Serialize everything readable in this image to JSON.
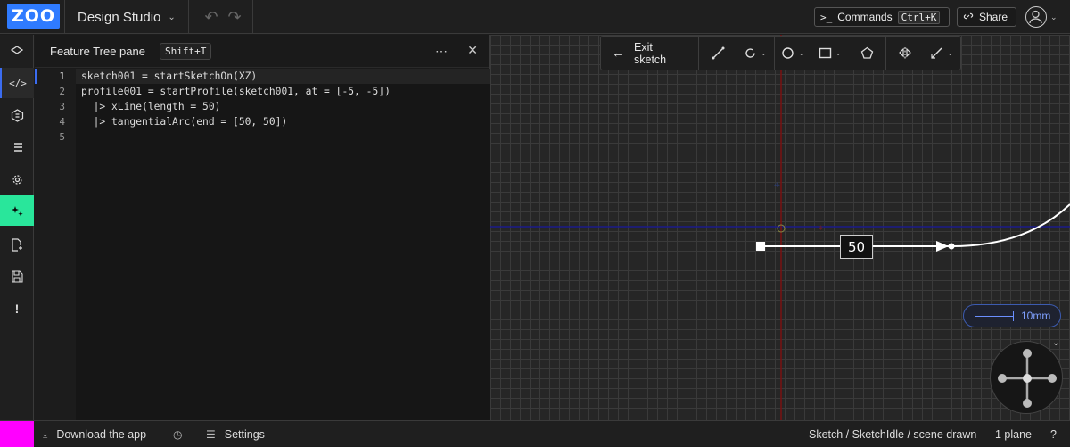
{
  "header": {
    "logo_text": "ZOO",
    "project_name": "Design Studio",
    "commands_label": "Commands",
    "commands_shortcut": "Ctrl+K",
    "share_label": "Share"
  },
  "sidebar": {
    "items": [
      {
        "icon": "layers-icon"
      },
      {
        "icon": "code-icon"
      },
      {
        "icon": "feature-tree-icon"
      },
      {
        "icon": "list-icon"
      },
      {
        "icon": "gear-icon"
      },
      {
        "icon": "sparkle-icon",
        "active": true
      },
      {
        "icon": "file-export-icon"
      },
      {
        "icon": "save-icon"
      },
      {
        "icon": "alert-icon"
      }
    ]
  },
  "pane": {
    "title": "Feature Tree pane",
    "shortcut": "Shift+T",
    "more_glyph": "⋯",
    "close_glyph": "✕"
  },
  "editor": {
    "line_numbers": [
      "1",
      "2",
      "3",
      "4",
      "5"
    ],
    "lines": [
      "sketch001 = startSketchOn(XZ)",
      "profile001 = startProfile(sketch001, at = [-5, -5])",
      "  |> xLine(length = 50)",
      "  |> tangentialArc(end = [50, 50])",
      ""
    ],
    "active_line": 0
  },
  "sketch_toolbar": {
    "exit_label": "Exit sketch",
    "tools": [
      "line-tool-icon",
      "arc-tool-icon",
      "circle-tool-icon",
      "rectangle-tool-icon",
      "polygon-tool-icon",
      "mirror-tool-icon",
      "constraint-tool-icon"
    ]
  },
  "viewport": {
    "dimension_value": "50",
    "scale_label": "10mm",
    "colors": {
      "grid": "#3a3a3a",
      "x_axis": "#1a1a8a",
      "y_axis": "#7a1010",
      "sketch": "#ffffff",
      "accent": "#29e69b"
    }
  },
  "statusbar": {
    "download_label": "Download the app",
    "settings_label": "Settings",
    "status_text": "Sketch / SketchIdle / scene drawn",
    "planes_text": "1 plane",
    "help_glyph": "?"
  }
}
